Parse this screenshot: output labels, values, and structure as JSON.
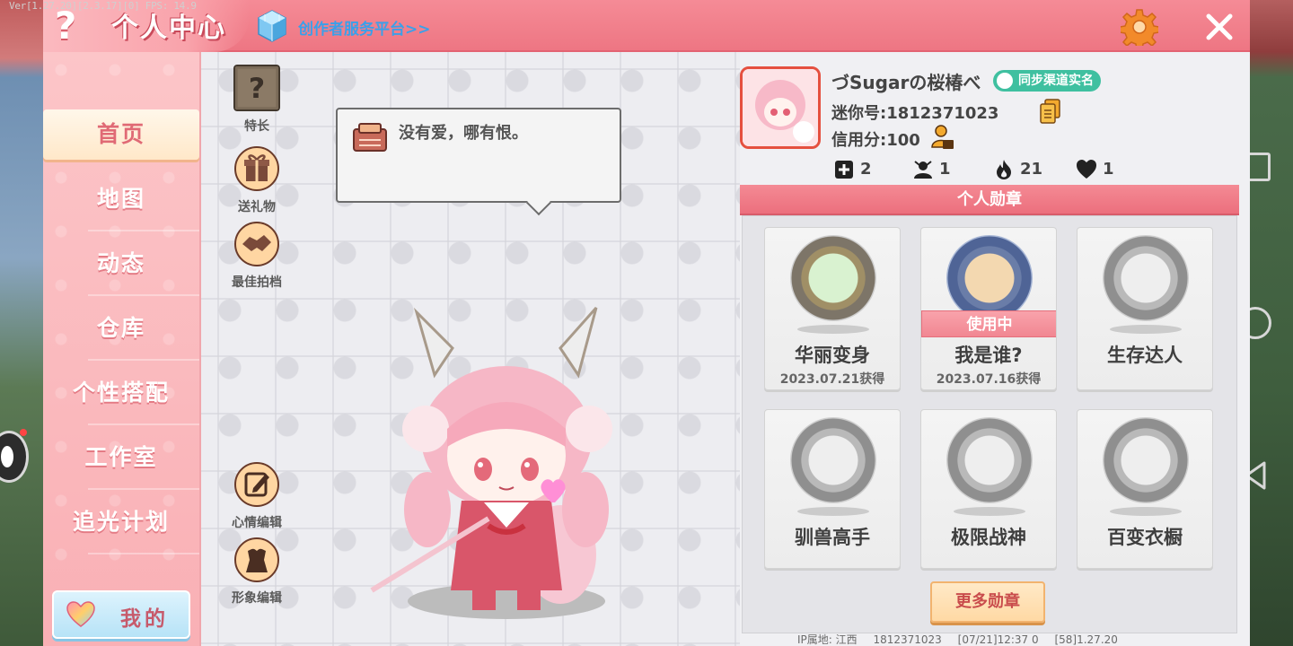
{
  "debug_overlay": "Ver[1.27.20][2.3.17][0] FPS: 14.9",
  "header": {
    "title": "个人中心",
    "creator_link": "创作者服务平台>>",
    "help_icon": "question-mark-icon",
    "settings_icon": "gear-icon",
    "close_icon": "close-icon"
  },
  "sidebar": {
    "items": [
      {
        "label": "首页",
        "active": true
      },
      {
        "label": "地图",
        "active": false
      },
      {
        "label": "动态",
        "active": false
      },
      {
        "label": "仓库",
        "active": false
      },
      {
        "label": "个性搭配",
        "active": false
      },
      {
        "label": "工作室",
        "active": false
      },
      {
        "label": "追光计划",
        "active": false
      }
    ],
    "mine_label": "我的"
  },
  "actions": {
    "specialty": "特长",
    "send_gift": "送礼物",
    "best_partner": "最佳拍档",
    "mood_edit": "心情编辑",
    "image_edit": "形象编辑"
  },
  "speech": {
    "text": "没有爱，哪有恨。"
  },
  "profile": {
    "name": "づSugarの桜椿べ",
    "badge": "同步渠道实名",
    "mini_id": "迷你号:1812371023",
    "credit": "信用分:100",
    "stats": {
      "friends": "2",
      "followers": "1",
      "hot": "21",
      "likes": "1"
    }
  },
  "medals": {
    "header": "个人勋章",
    "in_use_label": "使用中",
    "items": [
      {
        "name": "华丽变身",
        "date": "2023.07.21获得"
      },
      {
        "name": "我是谁?",
        "date": "2023.07.16获得",
        "in_use": true
      },
      {
        "name": "生存达人",
        "date": ""
      },
      {
        "name": "驯兽高手",
        "date": ""
      },
      {
        "name": "极限战神",
        "date": ""
      },
      {
        "name": "百变衣橱",
        "date": ""
      }
    ],
    "more_button": "更多勋章"
  },
  "footer": {
    "ip_location": "IP属地: 江西",
    "uid": "1812371023",
    "time": "[07/21]12:37 0",
    "version": "[58]1.27.20"
  },
  "colors": {
    "header_pink": "#ee7683",
    "sidebar_pink": "#fcc5c8",
    "link_blue": "#3aa0ea",
    "badge_green": "#3fc0a0"
  }
}
